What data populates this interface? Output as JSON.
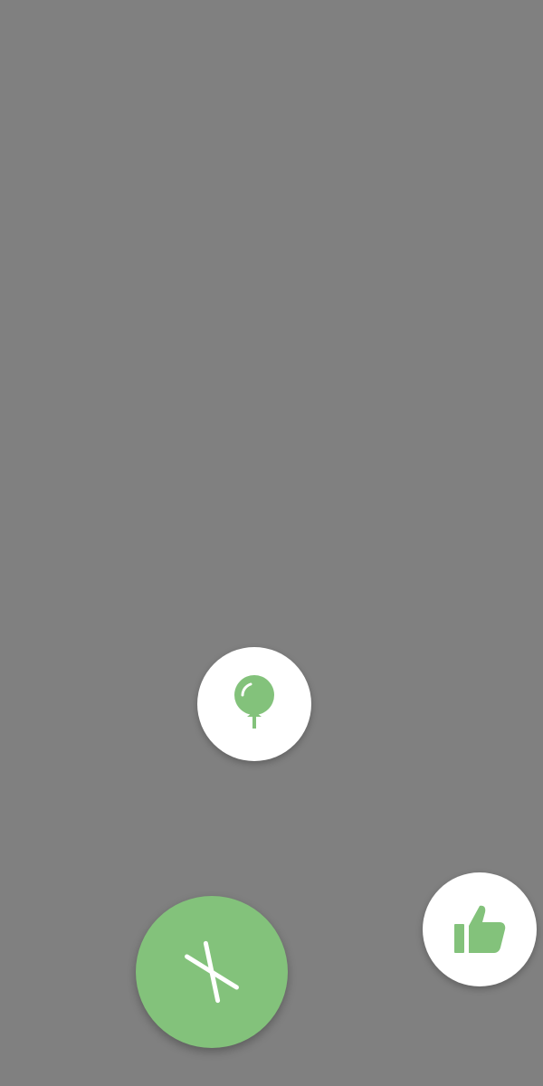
{
  "colors": {
    "background_overlay": "#808080",
    "accent": "#83c27b",
    "button_surface": "#ffffff",
    "fab_icon": "#ffffff"
  },
  "actions": [
    {
      "id": "balloon",
      "icon": "balloon-icon"
    },
    {
      "id": "like",
      "icon": "thumbs-up-icon"
    }
  ],
  "fab": {
    "icon": "close-icon",
    "state": "expanded"
  }
}
